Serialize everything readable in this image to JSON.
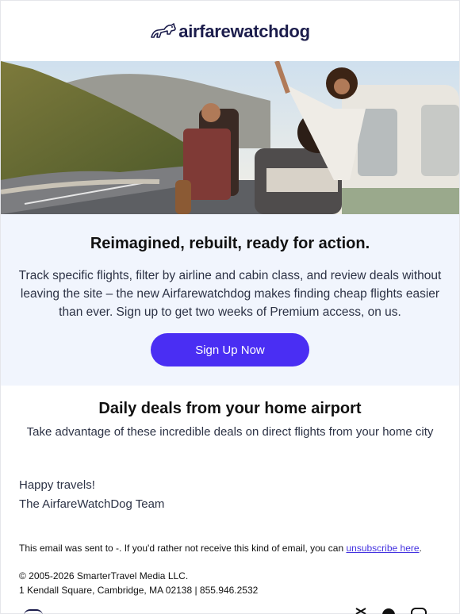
{
  "brand": {
    "logo_text": "airfarewatchdog",
    "accent": "#4a2ef3",
    "navy": "#1c1d4c"
  },
  "promo": {
    "headline": "Reimagined, rebuilt, ready for action.",
    "body": "Track specific flights, filter by airline and cabin class, and review deals without leaving the site – the new Airfarewatchdog makes finding cheap flights easier than ever. Sign up to get two weeks of Premium access, on us.",
    "cta_label": "Sign Up Now"
  },
  "deals": {
    "heading": "Daily deals from your home airport",
    "subheading": "Take advantage of these incredible deals on direct flights from your home city"
  },
  "signoff": {
    "line1": "Happy travels!",
    "line2": "The AirfareWatchDog Team"
  },
  "legal": {
    "sent_text": "This email was sent to -. If you'd rather not receive this kind of email, you can ",
    "unsubscribe_label": "unsubscribe here",
    "sent_suffix": ".",
    "copyright": "© 2005-2026 SmarterTravel Media LLC.",
    "address": "1 Kendall Square, Cambridge, MA 02138 | 855.946.2532"
  },
  "footer": {
    "social_icons": [
      "x-icon",
      "facebook-icon",
      "instagram-icon"
    ]
  }
}
